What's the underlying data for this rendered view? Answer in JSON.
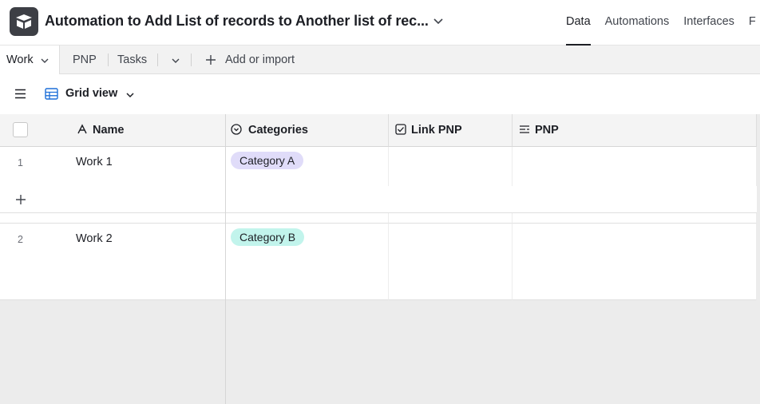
{
  "header": {
    "base_title": "Automation to Add List of records to Another list of rec...",
    "nav": [
      "Data",
      "Automations",
      "Interfaces",
      "F"
    ]
  },
  "tabs": {
    "items": [
      "Work",
      "PNP",
      "Tasks"
    ],
    "add_import": "Add or import"
  },
  "view": {
    "name": "Grid view"
  },
  "grid": {
    "columns": [
      "Name",
      "Categories",
      "Link PNP",
      "PNP"
    ],
    "rows": [
      {
        "num": "1",
        "name": "Work 1",
        "category": "Category A"
      },
      {
        "num": "2",
        "name": "Work 2",
        "category": "Category B"
      }
    ]
  },
  "colors": {
    "category_a": "#e0dcf9",
    "category_b": "#c2f4ec"
  }
}
